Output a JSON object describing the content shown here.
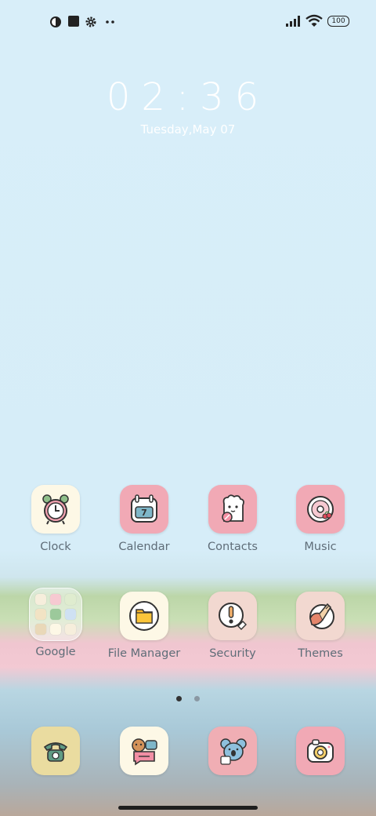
{
  "status_bar": {
    "battery": "100",
    "left_icons": [
      "circle-half-icon",
      "square-icon",
      "gear-icon",
      "more-dots-icon"
    ],
    "right_icons": [
      "signal-icon",
      "wifi-icon",
      "battery-icon"
    ]
  },
  "lock_clock": {
    "time": "02:36",
    "date": "Tuesday,May 07"
  },
  "apps_row1": [
    {
      "label": "Clock",
      "icon": "alarm-clock-icon"
    },
    {
      "label": "Calendar",
      "icon": "calendar-icon"
    },
    {
      "label": "Contacts",
      "icon": "contacts-sheep-icon"
    },
    {
      "label": "Music",
      "icon": "record-disc-icon"
    }
  ],
  "apps_row2": [
    {
      "label": "Google",
      "icon": "folder-icon"
    },
    {
      "label": "File Manager",
      "icon": "folder-file-icon"
    },
    {
      "label": "Security",
      "icon": "security-exclamation-icon"
    },
    {
      "label": "Themes",
      "icon": "paint-brush-icon"
    }
  ],
  "dock": [
    {
      "icon": "phone-icon"
    },
    {
      "icon": "messages-icon"
    },
    {
      "icon": "gallery-koala-icon"
    },
    {
      "icon": "camera-icon"
    }
  ],
  "page_indicator": {
    "pages": 2,
    "current": 1
  },
  "colors": {
    "sky": "#d8eef9",
    "tile_pink": "#f1a9b5",
    "tile_cream": "#fdf8e6",
    "label": "#5f6d78"
  }
}
